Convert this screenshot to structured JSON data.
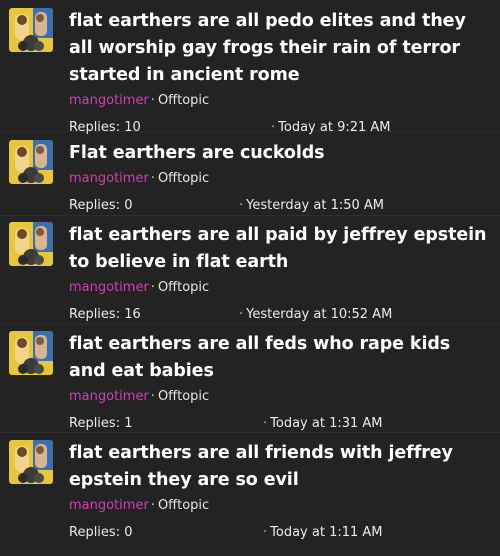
{
  "threads": [
    {
      "title": "flat earthers are all pedo elites and they all worship gay frogs their rain of terror started in ancient rome",
      "author": "mangotimer",
      "forum": "Offtopic",
      "replies": "Replies: 10",
      "last_post": "Today at 9:21 AM"
    },
    {
      "title": "Flat earthers are cuckolds",
      "author": "mangotimer",
      "forum": "Offtopic",
      "replies": "Replies: 0",
      "last_post": "Yesterday at 1:50 AM"
    },
    {
      "title": "flat earthers are all paid by jeffrey epstein to believe in flat earth",
      "author": "mangotimer",
      "forum": "Offtopic",
      "replies": "Replies: 16",
      "last_post": "Yesterday at 10:52 AM"
    },
    {
      "title": "flat earthers are all feds who rape kids and eat babies",
      "author": "mangotimer",
      "forum": "Offtopic",
      "replies": "Replies: 1",
      "last_post": "Today at 1:31 AM"
    },
    {
      "title": "flat earthers are all friends with jeffrey epstein they are so evil",
      "author": "mangotimer",
      "forum": "Offtopic",
      "replies": "Replies: 0",
      "last_post": "Today at 1:11 AM"
    }
  ],
  "separator": "·",
  "colors": {
    "background": "#232323",
    "author": "#d23fb4",
    "title": "#ffffff"
  }
}
